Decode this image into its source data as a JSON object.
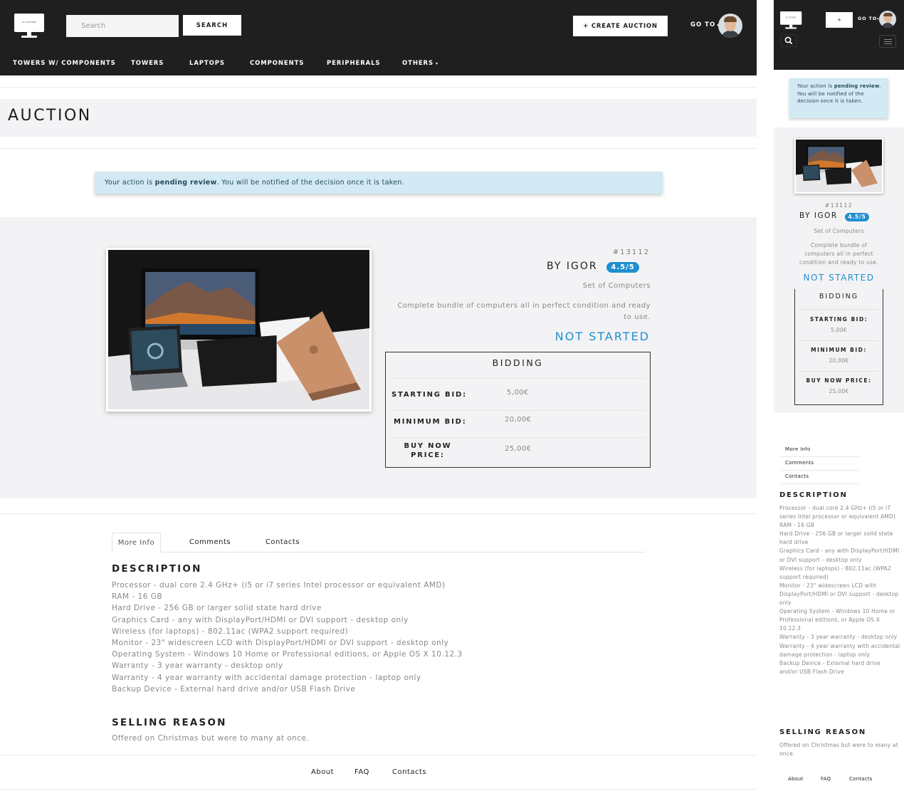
{
  "brand": {
    "logo_text": "PC AUCTIONS"
  },
  "header": {
    "search_placeholder": "Search",
    "search_button": "SEARCH",
    "create_button": "+ CREATE AUCTION",
    "goto_label": "GO TO",
    "caret": "▾"
  },
  "nav": {
    "items": [
      {
        "label": "TOWERS W/ COMPONENTS"
      },
      {
        "label": "TOWERS"
      },
      {
        "label": "LAPTOPS"
      },
      {
        "label": "COMPONENTS"
      },
      {
        "label": "PERIPHERALS"
      },
      {
        "label": "OTHERS"
      }
    ]
  },
  "page": {
    "title": "AUCTION"
  },
  "alert": {
    "prefix": "Your action is ",
    "strong": "pending review",
    "suffix": ". You will be notified of the decision once it is taken."
  },
  "auction": {
    "lot_id": "#13112",
    "seller": "BY IGOR",
    "rating": "4.5/5",
    "category": "Set of Computers",
    "short_description": "Complete bundle of computers all in perfect condition and ready to use.",
    "status": "NOT STARTED",
    "image_alt": "Bundle of computers: iMac, laptops and notebooks"
  },
  "bidding": {
    "title": "BIDDING",
    "starting_label": "STARTING BID:",
    "starting_value": "5,00€",
    "minimum_label": "MINIMUM BID:",
    "minimum_value": "20,00€",
    "buynow_label_line1": "BUY NOW",
    "buynow_label_line2": "PRICE:",
    "buynow_label": "BUY NOW PRICE:",
    "buynow_value": "25,00€"
  },
  "tabs": [
    {
      "label": "More Info",
      "active": true
    },
    {
      "label": "Comments",
      "active": false
    },
    {
      "label": "Contacts",
      "active": false
    }
  ],
  "description": {
    "title": "DESCRIPTION",
    "lines": [
      "Processor - dual core 2.4 GHz+ (i5 or i7 series Intel processor or equivalent AMD)",
      "RAM - 16 GB",
      "Hard Drive - 256 GB or larger solid state hard drive",
      "Graphics Card - any with DisplayPort/HDMI or DVI support - desktop only",
      "Wireless (for laptops) - 802.11ac (WPA2 support required)",
      "Monitor - 23\" widescreen LCD with DisplayPort/HDMI or DVI support - desktop only",
      "Operating System - Windows 10 Home or Professional editions, or Apple OS X 10.12.3",
      "Warranty - 3 year warranty - desktop only",
      "Warranty - 4 year warranty with accidental damage protection - laptop only",
      "Backup Device - External hard drive and/or USB Flash Drive"
    ]
  },
  "selling_reason": {
    "title": "SELLING REASON",
    "text": "Offered on Christmas but were to many at once."
  },
  "footer": {
    "links": [
      "About",
      "FAQ",
      "Contacts"
    ]
  },
  "mobile": {
    "plus_button": "+"
  },
  "colors": {
    "topbar": "#1f1f1f",
    "accent": "#1f8fcf",
    "alert_bg": "#d3e9f3",
    "band": "#f3f3f5"
  },
  "icons": [
    "monitor-logo-icon",
    "search-icon",
    "hamburger-icon",
    "caret-down-icon",
    "user-avatar"
  ]
}
